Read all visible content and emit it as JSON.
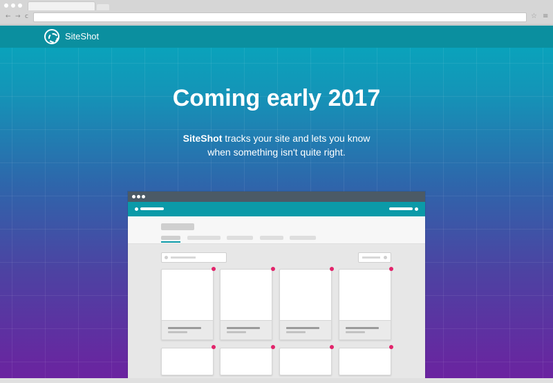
{
  "browser": {
    "nav": {
      "back": "←",
      "forward": "→",
      "reload": "c"
    },
    "url": "",
    "star": "☆",
    "menu": "≡"
  },
  "header": {
    "brand": "SiteShot"
  },
  "hero": {
    "title": "Coming early 2017",
    "tagline_bold": "SiteShot",
    "tagline_rest": "tracks your site and lets you know when something isn't quite right."
  },
  "colors": {
    "accent": "#0b9aa8",
    "alert": "#e2246b"
  }
}
